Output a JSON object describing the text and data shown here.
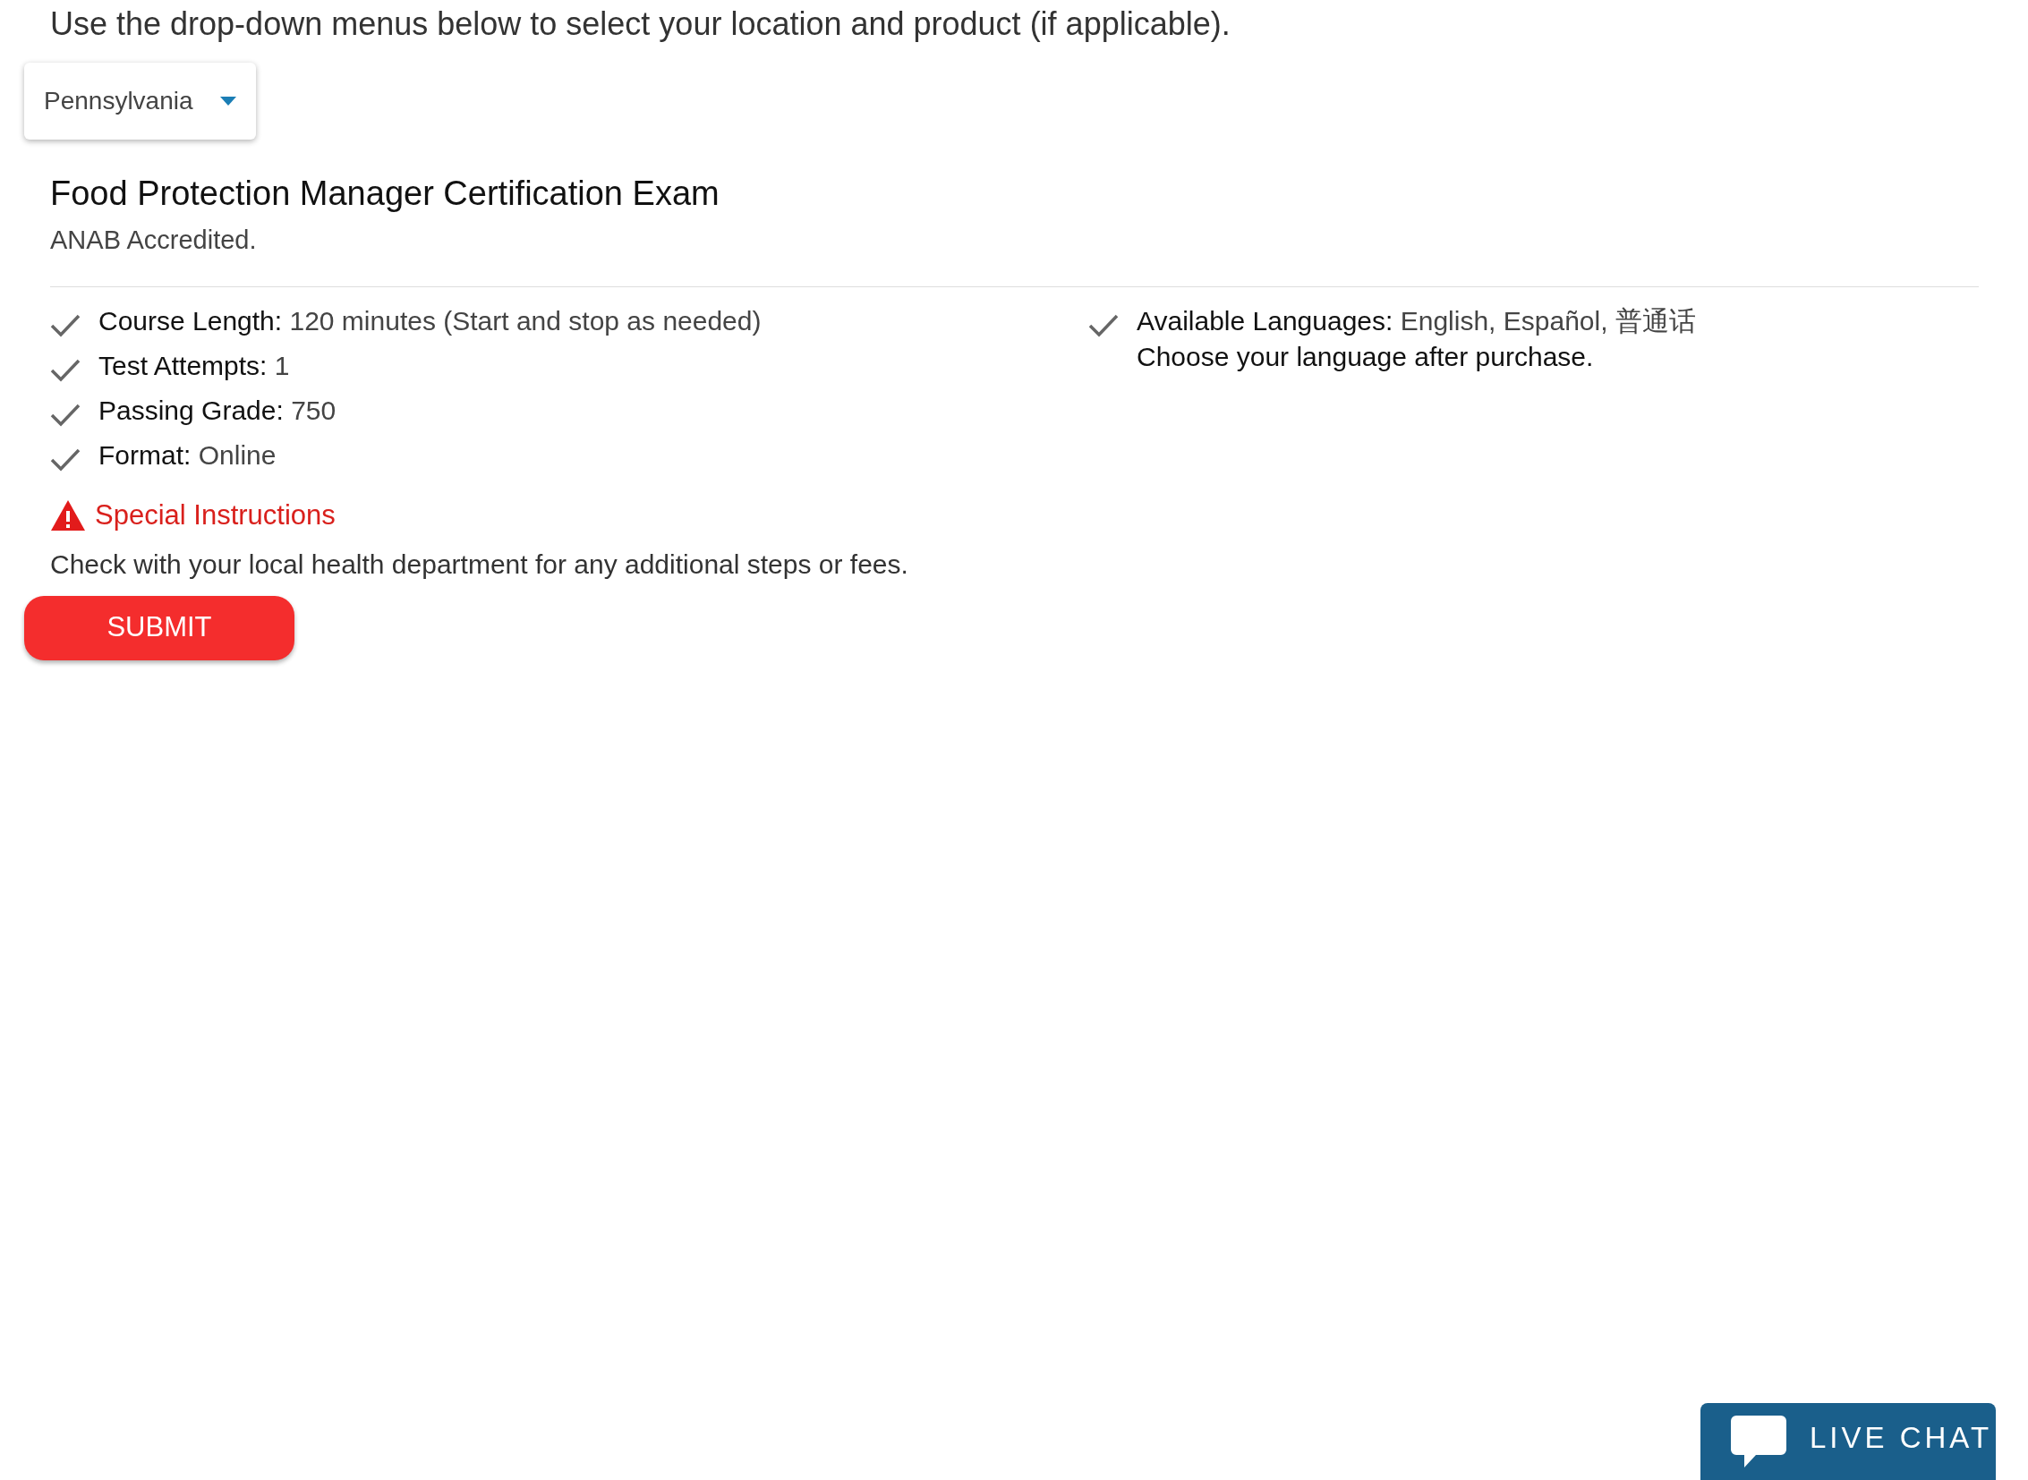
{
  "intro": "Use the drop-down menus below to select your location and product (if applicable).",
  "location_dropdown": {
    "value": "Pennsylvania"
  },
  "product": {
    "title": "Food Protection Manager Certification Exam",
    "subtitle": "ANAB Accredited."
  },
  "features_left": [
    {
      "label": "Course Length:",
      "value": "120 minutes (Start and stop as needed)"
    },
    {
      "label": "Test Attempts:",
      "value": "1"
    },
    {
      "label": "Passing Grade:",
      "value": "750"
    },
    {
      "label": "Format:",
      "value": "Online"
    }
  ],
  "features_right": [
    {
      "label": "Available Languages:",
      "value": "English, Español, 普通话",
      "note": "Choose your language after purchase."
    }
  ],
  "special_instructions": {
    "heading": "Special Instructions",
    "text": "Check with your local health department for any additional steps or fees."
  },
  "submit_button": "SUBMIT",
  "live_chat_button": "LIVE CHAT"
}
